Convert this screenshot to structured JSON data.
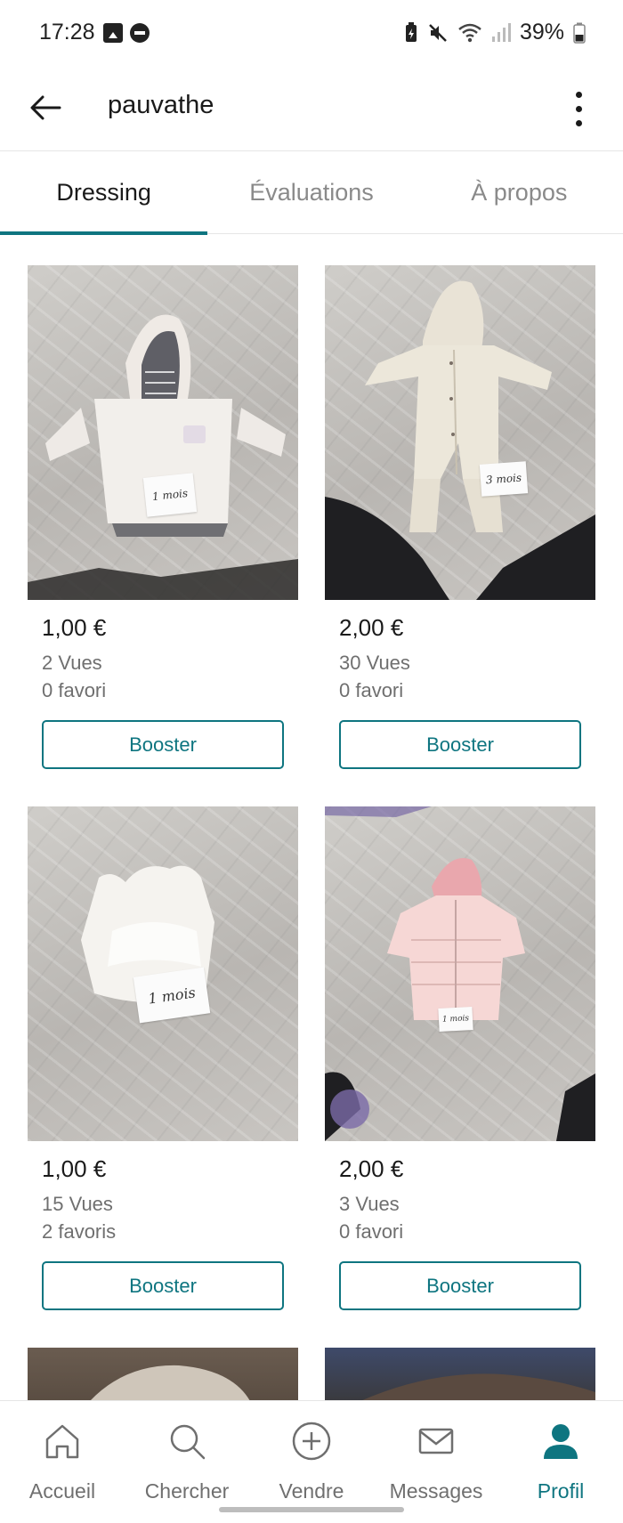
{
  "status_bar": {
    "time": "17:28",
    "battery": "39%",
    "icons": [
      "gallery-icon",
      "do-not-disturb-icon",
      "battery-saver-icon",
      "mute-icon",
      "wifi-icon",
      "signal-icon",
      "battery-icon"
    ]
  },
  "header": {
    "title": "pauvathe",
    "back_icon": "arrow-left-icon",
    "menu_icon": "more-vertical-icon"
  },
  "tabs": [
    {
      "label": "Dressing",
      "active": true
    },
    {
      "label": "Évaluations",
      "active": false
    },
    {
      "label": "À propos",
      "active": false
    }
  ],
  "items": [
    {
      "price": "1,00 €",
      "views": "2 Vues",
      "favorites": "0 favori",
      "button": "Booster",
      "tag": "1 mois",
      "photo": "white fleece hooded jacket with striped lining"
    },
    {
      "price": "2,00 €",
      "views": "30 Vues",
      "favorites": "0 favori",
      "button": "Booster",
      "tag": "3 mois",
      "photo": "cream hooded snowsuit"
    },
    {
      "price": "1,00 €",
      "views": "15 Vues",
      "favorites": "2 favoris",
      "button": "Booster",
      "tag": "1 mois",
      "photo": "white faux fur vest"
    },
    {
      "price": "2,00 €",
      "views": "3 Vues",
      "favorites": "0 favori",
      "button": "Booster",
      "tag": "1 mois",
      "photo": "pink puffer jacket"
    }
  ],
  "bottom_nav": [
    {
      "label": "Accueil",
      "icon": "home-icon",
      "active": false
    },
    {
      "label": "Chercher",
      "icon": "search-icon",
      "active": false
    },
    {
      "label": "Vendre",
      "icon": "plus-circle-icon",
      "active": false
    },
    {
      "label": "Messages",
      "icon": "mail-icon",
      "active": false
    },
    {
      "label": "Profil",
      "icon": "profile-icon",
      "active": true
    }
  ],
  "colors": {
    "accent": "#0e7580",
    "text": "#1a1a1a",
    "muted": "#6f6f6f"
  }
}
